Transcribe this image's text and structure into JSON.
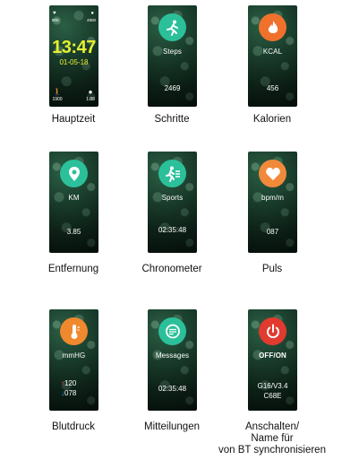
{
  "main_face": {
    "time": "13:47",
    "date": "01-05-18",
    "top_left_value": "900",
    "top_right_value": "4900",
    "bottom_left_value": "1900",
    "bottom_right_value": "1.88",
    "caption": "Hauptzeit"
  },
  "screens": [
    {
      "label": "Steps",
      "value": "2469",
      "caption": "Schritte",
      "icon": "running-person-icon",
      "color": "#2bc09a"
    },
    {
      "label": "KCAL",
      "value": "456",
      "caption": "Kalorien",
      "icon": "flame-icon",
      "color": "#f0712c"
    },
    {
      "label": "KM",
      "value": "3.85",
      "caption": "Entfernung",
      "icon": "location-pin-icon",
      "color": "#2bc09a"
    },
    {
      "label": "Sports",
      "value": "02:35:48",
      "caption": "Chronometer",
      "icon": "sports-runner-icon",
      "color": "#2bc09a"
    },
    {
      "label": "bpm/m",
      "value": "087",
      "caption": "Puls",
      "icon": "heart-icon",
      "color": "#f08a3a"
    },
    {
      "label": "mmHG",
      "value_up": "120",
      "value_down": "078",
      "caption": "Blutdruck",
      "icon": "thermometer-icon",
      "color": "#f0882e",
      "up_arrow": "↑",
      "down_arrow": "↓"
    },
    {
      "label": "Messages",
      "value": "02:35:48",
      "caption": "Mitteilungen",
      "icon": "message-bubble-icon",
      "color": "#2bc09a"
    },
    {
      "label": "OFF/ON",
      "value_line1": "G16/V3.4",
      "value_line2": "C68E",
      "caption_line1": "Anschalten/",
      "caption_line2": "Name für",
      "caption_line3": "von BT synchronisieren",
      "icon": "power-icon",
      "color": "#e23a2e"
    }
  ]
}
